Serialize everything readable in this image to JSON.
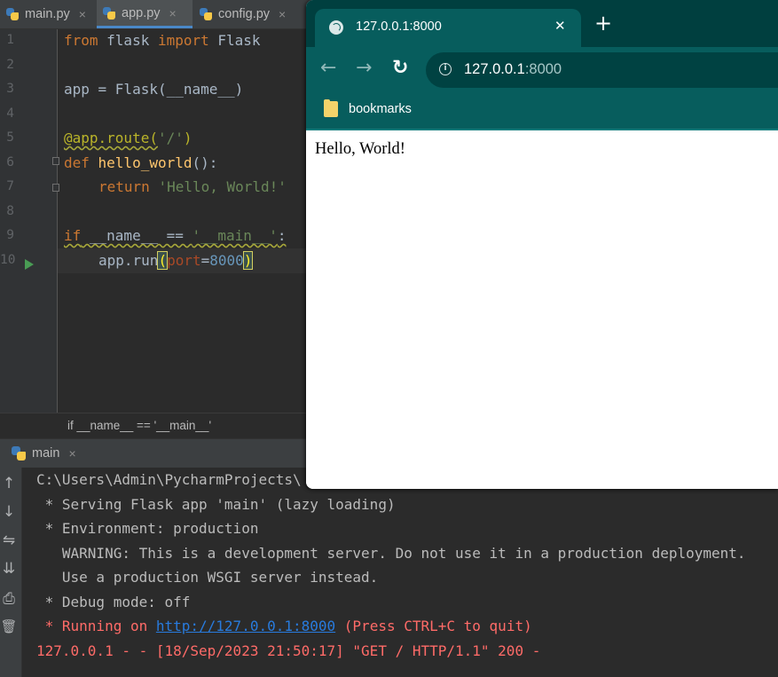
{
  "editor": {
    "tabs": [
      {
        "label": "main.py",
        "close": "×"
      },
      {
        "label": "app.py",
        "close": "×"
      },
      {
        "label": "config.py",
        "close": "×"
      }
    ],
    "line_numbers": [
      "1",
      "2",
      "3",
      "4",
      "5",
      "6",
      "7",
      "8",
      "9",
      "10"
    ],
    "code": {
      "l1_kw1": "from",
      "l1_mod": " flask ",
      "l1_kw2": "import",
      "l1_name": " Flask",
      "l3": "app = Flask(__name__)",
      "l5_deco": "@app.route(",
      "l5_str": "'/'",
      "l5_end": ")",
      "l6_kw": "def ",
      "l6_fn": "hello_world",
      "l6_end": "():",
      "l7_kw": "return ",
      "l7_str": "'Hello, World!'",
      "l9_kw": "if",
      "l9_mid": " __name__ == ",
      "l9_str": "'__main__'",
      "l9_end": ":",
      "l10_pre": "app.run",
      "l10_open": "(",
      "l10_param": "port",
      "l10_eq": "=",
      "l10_num": "8000",
      "l10_close": ")"
    },
    "breadcrumb": "if __name__ == '__main__'"
  },
  "run_panel": {
    "tab_label": "main",
    "tab_close": "×",
    "toolbar_icons": [
      "arrow-up-icon",
      "arrow-down-icon",
      "soft-wrap-icon",
      "scroll-to-end-icon",
      "print-icon",
      "trash-icon"
    ],
    "toolbar_glyphs": [
      "↑",
      "↓",
      "⇋",
      "⇊",
      "⎙",
      "🗑"
    ],
    "console": {
      "line1": "C:\\Users\\Admin\\PycharmProjects\\",
      "line2": " * Serving Flask app 'main' (lazy loading)",
      "line3": " * Environment: production",
      "line4": "   WARNING: This is a development server. Do not use it in a production deployment.",
      "line5": "   Use a production WSGI server instead.",
      "line6": " * Debug mode: off",
      "line7_pre": " * Running on ",
      "line7_link": "http://127.0.0.1:8000",
      "line7_post": " (Press CTRL+C to quit)",
      "line8": "127.0.0.1 - - [18/Sep/2023 21:50:17] \"GET / HTTP/1.1\" 200 -"
    }
  },
  "browser": {
    "tab_title": "127.0.0.1:8000",
    "tab_close": "✕",
    "new_tab": "+",
    "back": "←",
    "forward": "→",
    "reload": "↻",
    "info": "i",
    "url_host": "127.0.0.1",
    "url_port": ":8000",
    "bookmarks_label": "bookmarks",
    "page_text": "Hello, World!",
    "colors": {
      "frame": "#003f3f",
      "toolbar": "#075d5d"
    }
  }
}
